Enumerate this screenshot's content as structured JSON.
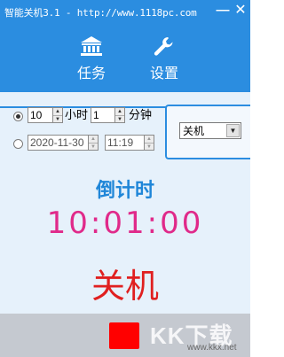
{
  "window": {
    "title": "智能关机3.1 - http://www.1118pc.com",
    "minimize_glyph": "—",
    "close_glyph": "✕"
  },
  "nav": {
    "items": [
      {
        "label": "任务",
        "icon": "bank-icon"
      },
      {
        "label": "设置",
        "icon": "wrench-icon"
      }
    ]
  },
  "timer": {
    "relative": {
      "selected": true,
      "hours": "10",
      "hours_unit": "小时",
      "minutes": "1",
      "minutes_unit": "分钟"
    },
    "absolute": {
      "selected": false,
      "date": "2020-11-30",
      "time": "11:19"
    }
  },
  "action": {
    "selected": "关机"
  },
  "countdown": {
    "label": "倒计时",
    "time": "10:01:00"
  },
  "status": {
    "action_label": "关机"
  },
  "footer": {
    "stop_color": "#ff0000",
    "watermark": "KK下载",
    "watermark_url": "www.kkx.net"
  },
  "colors": {
    "accent": "#2b8de0",
    "countdown": "#e02a8a",
    "status": "#e02020"
  }
}
